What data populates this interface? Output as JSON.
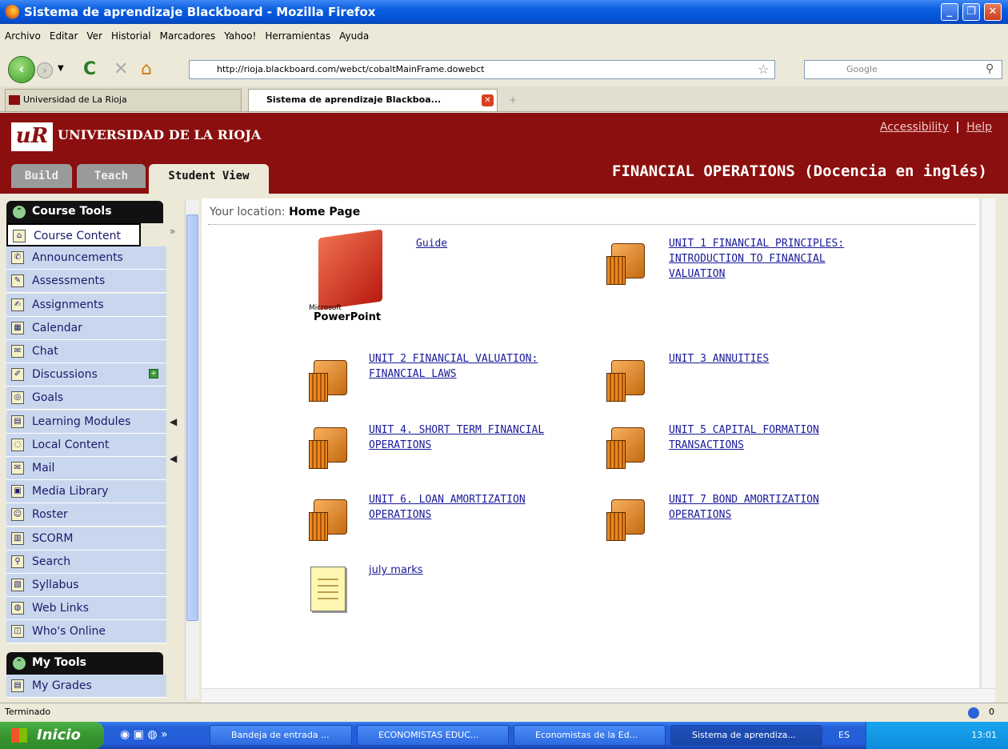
{
  "window": {
    "title": "Sistema de aprendizaje Blackboard - Mozilla Firefox"
  },
  "menu": [
    "Archivo",
    "Editar",
    "Ver",
    "Historial",
    "Marcadores",
    "Yahoo!",
    "Herramientas",
    "Ayuda"
  ],
  "nav": {
    "url": "http://rioja.blackboard.com/webct/cobaltMainFrame.dowebct",
    "search_placeholder": "Google"
  },
  "tabs": [
    {
      "label": "Universidad de La Rioja",
      "active": false
    },
    {
      "label": "Sistema de aprendizaje Blackboa...",
      "active": true
    }
  ],
  "header": {
    "university": "UNIVERSIDAD DE LA RIOJA",
    "accessibility": "Accessibility",
    "separator": "|",
    "help": "Help",
    "view_tabs": [
      "Build",
      "Teach",
      "Student View"
    ],
    "course_title": "FINANCIAL OPERATIONS (Docencia en inglés)"
  },
  "sidebar": {
    "course_tools_title": "Course Tools",
    "items": [
      {
        "label": "Course Content",
        "icon": "home-icon"
      },
      {
        "label": "Announcements",
        "icon": "megaphone-icon"
      },
      {
        "label": "Assessments",
        "icon": "assessment-icon"
      },
      {
        "label": "Assignments",
        "icon": "assignment-icon"
      },
      {
        "label": "Calendar",
        "icon": "calendar-icon"
      },
      {
        "label": "Chat",
        "icon": "chat-icon"
      },
      {
        "label": "Discussions",
        "icon": "discussion-icon"
      },
      {
        "label": "Goals",
        "icon": "goals-icon"
      },
      {
        "label": "Learning Modules",
        "icon": "modules-icon"
      },
      {
        "label": "Local Content",
        "icon": "local-content-icon"
      },
      {
        "label": "Mail",
        "icon": "mail-icon"
      },
      {
        "label": "Media Library",
        "icon": "media-icon"
      },
      {
        "label": "Roster",
        "icon": "roster-icon"
      },
      {
        "label": "SCORM",
        "icon": "scorm-icon"
      },
      {
        "label": "Search",
        "icon": "search-icon"
      },
      {
        "label": "Syllabus",
        "icon": "syllabus-icon"
      },
      {
        "label": "Web Links",
        "icon": "weblinks-icon"
      },
      {
        "label": "Who's Online",
        "icon": "online-icon"
      }
    ],
    "my_tools_title": "My Tools",
    "my_tools_items": [
      {
        "label": "My Grades",
        "icon": "grades-icon"
      }
    ]
  },
  "content": {
    "location_label": "Your location:",
    "location_value": "Home Page",
    "powerpoint_brand_small": "Microsoft",
    "powerpoint_brand": "PowerPoint",
    "items": [
      {
        "label": "Guide",
        "kind": "powerpoint"
      },
      {
        "label": "UNIT 1 FINANCIAL PRINCIPLES: INTRODUCTION TO FINANCIAL VALUATION",
        "kind": "folder"
      },
      {
        "label": "UNIT 2 FINANCIAL VALUATION: FINANCIAL LAWS",
        "kind": "folder"
      },
      {
        "label": "UNIT 3 ANNUITIES",
        "kind": "folder"
      },
      {
        "label": "UNIT 4. SHORT TERM FINANCIAL OPERATIONS",
        "kind": "folder"
      },
      {
        "label": "UNIT 5 CAPITAL FORMATION TRANSACTIONS",
        "kind": "folder"
      },
      {
        "label": "UNIT 6. LOAN AMORTIZATION OPERATIONS",
        "kind": "folder"
      },
      {
        "label": "UNIT 7 BOND AMORTIZATION OPERATIONS",
        "kind": "folder"
      },
      {
        "label": "july marks",
        "kind": "document"
      }
    ]
  },
  "status": {
    "text": "Terminado",
    "count": "0"
  },
  "taskbar": {
    "start": "Inicio",
    "tasks": [
      "Bandeja de entrada ...",
      "ECONOMISTAS EDUC...",
      "Economistas de la Ed...",
      "Sistema de aprendiza..."
    ],
    "lang": "ES",
    "clock": "13:01"
  }
}
